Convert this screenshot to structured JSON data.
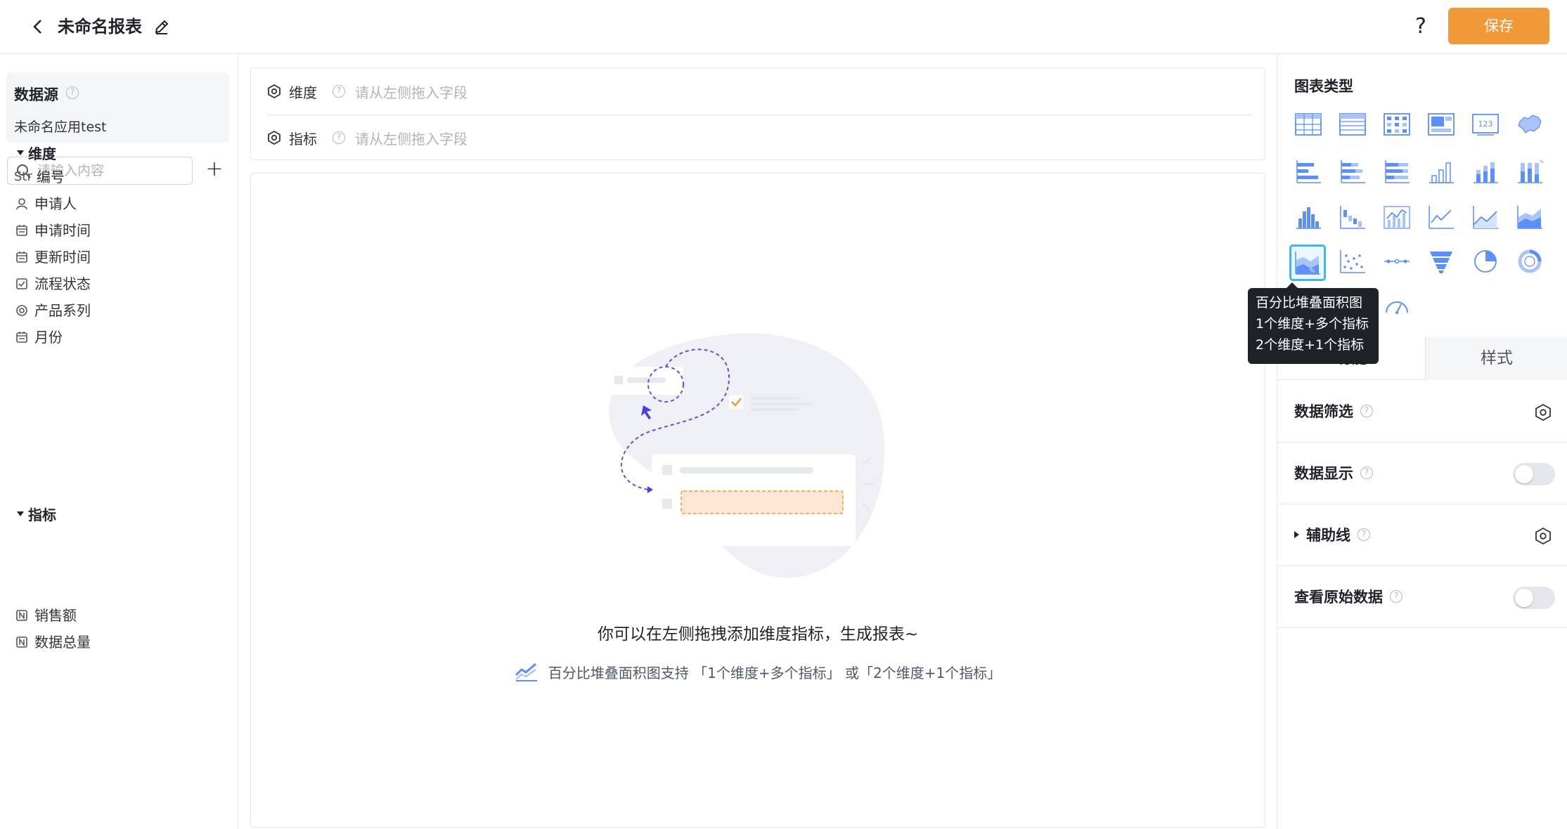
{
  "header": {
    "title": "未命名报表",
    "help": "?",
    "save_label": "保存"
  },
  "datasource": {
    "title": "数据源",
    "app_name": "未命名应用test",
    "search_placeholder": "请输入内容",
    "add": "+"
  },
  "fields": {
    "dimension_group": "维度",
    "dimensions": [
      {
        "icon": "Str",
        "label": "编号"
      },
      {
        "icon": "person-icon",
        "label": "申请人"
      },
      {
        "icon": "calendar-icon",
        "label": "申请时间"
      },
      {
        "icon": "calendar-icon",
        "label": "更新时间"
      },
      {
        "icon": "checkbox-icon",
        "label": "流程状态"
      },
      {
        "icon": "radio-icon",
        "label": "产品系列"
      },
      {
        "icon": "calendar-icon",
        "label": "月份"
      }
    ],
    "metric_group": "指标",
    "metrics": [
      {
        "icon": "number-icon",
        "label": "销售额"
      },
      {
        "icon": "number-icon",
        "label": "数据总量"
      }
    ]
  },
  "drop_zone": {
    "dimension_label": "维度",
    "metric_label": "指标",
    "placeholder": "请从左侧拖入字段"
  },
  "canvas": {
    "empty_title": "你可以在左侧拖拽添加维度指标，生成报表~",
    "empty_hint": "百分比堆叠面积图支持 「1个维度+多个指标」 或「2个维度+1个指标」"
  },
  "right_panel": {
    "chart_type_title": "图表类型",
    "tooltip": {
      "line1": "百分比堆叠面积图",
      "line2": "1个维度+多个指标",
      "line3": "2个维度+1个指标"
    },
    "tabs": {
      "func": "功能",
      "style": "样式"
    },
    "options": {
      "filter": "数据筛选",
      "display": "数据显示",
      "aux_line": "辅助线",
      "raw_data": "查看原始数据"
    },
    "number_icon_text": "123"
  },
  "colors": {
    "accent": "#f19838",
    "chart_icon": "#5b8ff9",
    "selected_border": "#3eb7ea"
  }
}
